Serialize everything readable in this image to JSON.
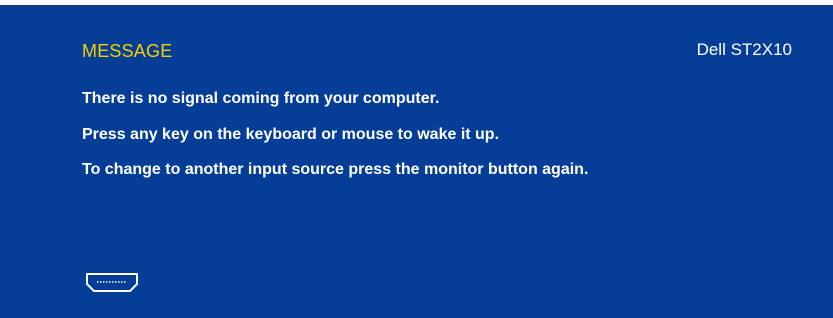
{
  "osd": {
    "title": "MESSAGE",
    "model": "Dell ST2X10",
    "messages": [
      "There is no signal coming from your computer.",
      "Press any key on the keyboard or mouse to wake it up.",
      "To change to another input source press the monitor button again."
    ],
    "input_icon": "hdmi-port-icon",
    "colors": {
      "background": "#063e97",
      "title": "#f5d000",
      "text": "#ffffff"
    }
  }
}
